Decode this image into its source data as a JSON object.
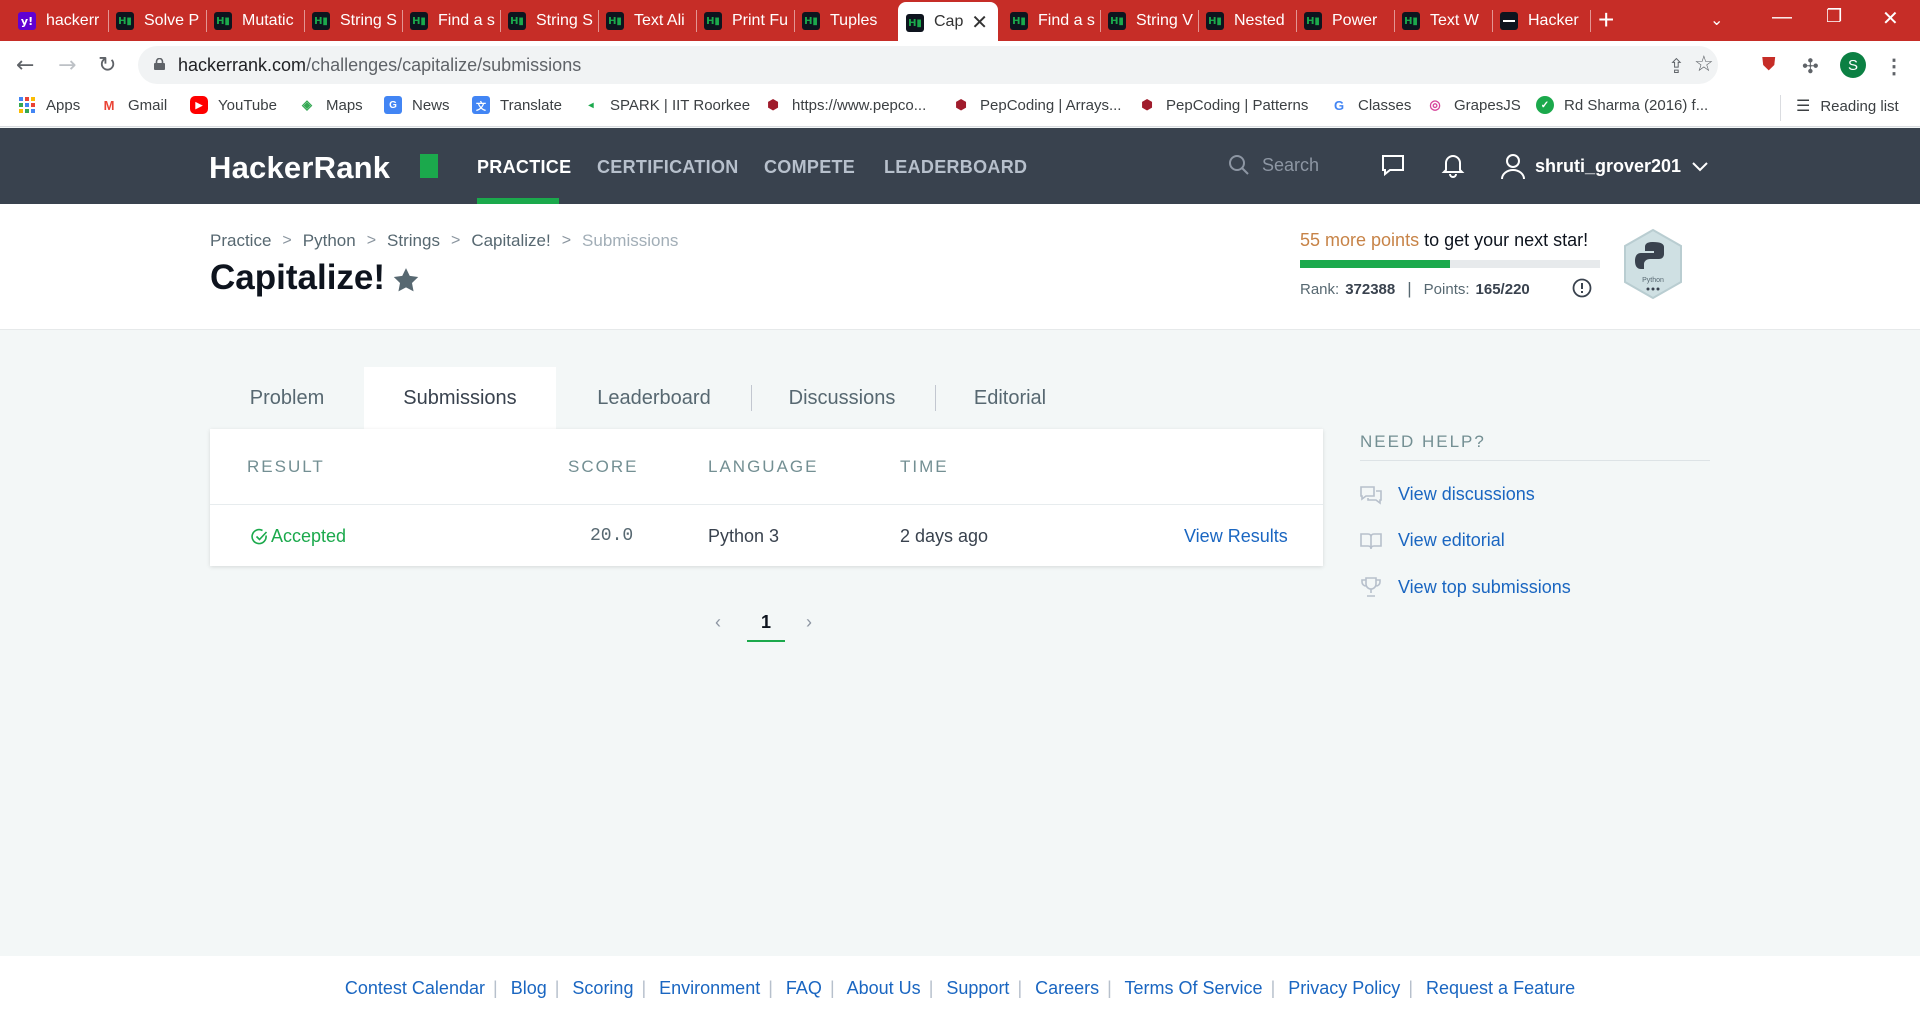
{
  "browser": {
    "tabs": [
      {
        "title": "hackerr",
        "favicon": "yahoo-icon"
      },
      {
        "title": "Solve P",
        "favicon": "hackerrank-icon"
      },
      {
        "title": "Mutatic",
        "favicon": "hackerrank-icon"
      },
      {
        "title": "String S",
        "favicon": "hackerrank-icon"
      },
      {
        "title": "Find a s",
        "favicon": "hackerrank-icon"
      },
      {
        "title": "String S",
        "favicon": "hackerrank-icon"
      },
      {
        "title": "Text Ali",
        "favicon": "hackerrank-icon"
      },
      {
        "title": "Print Fu",
        "favicon": "hackerrank-icon"
      },
      {
        "title": "Tuples",
        "favicon": "hackerrank-icon"
      },
      {
        "title": "Cap",
        "favicon": "hackerrank-icon",
        "active": true
      },
      {
        "title": "Find a s",
        "favicon": "hackerrank-icon"
      },
      {
        "title": "String V",
        "favicon": "hackerrank-icon"
      },
      {
        "title": "Nested",
        "favicon": "hackerrank-icon"
      },
      {
        "title": "Power",
        "favicon": "hackerrank-icon"
      },
      {
        "title": "Text W",
        "favicon": "hackerrank-icon"
      },
      {
        "title": "Hacker",
        "favicon": "hackerrank-dark-icon"
      }
    ],
    "url_host": "hackerrank.com",
    "url_path": "/challenges/capitalize/submissions",
    "profile_initial": "S",
    "bookmarks": [
      {
        "label": "Apps",
        "icon": "apps-grid-icon"
      },
      {
        "label": "Gmail",
        "icon": "gmail-icon"
      },
      {
        "label": "YouTube",
        "icon": "youtube-icon"
      },
      {
        "label": "Maps",
        "icon": "maps-icon"
      },
      {
        "label": "News",
        "icon": "news-icon"
      },
      {
        "label": "Translate",
        "icon": "translate-icon"
      },
      {
        "label": "SPARK | IIT Roorkee",
        "icon": "spark-icon"
      },
      {
        "label": "https://www.pepco...",
        "icon": "pepcoding-icon"
      },
      {
        "label": "PepCoding | Arrays...",
        "icon": "pepcoding-icon"
      },
      {
        "label": "PepCoding | Patterns",
        "icon": "pepcoding-icon"
      },
      {
        "label": "Classes",
        "icon": "google-icon"
      },
      {
        "label": "GrapesJS",
        "icon": "grapesjs-icon"
      },
      {
        "label": "Rd Sharma (2016) f...",
        "icon": "rd-sharma-icon"
      }
    ],
    "reading_list": "Reading list"
  },
  "hr_nav": {
    "logo": "HackerRank",
    "links": [
      "PRACTICE",
      "CERTIFICATION",
      "COMPETE",
      "LEADERBOARD"
    ],
    "search_placeholder": "Search",
    "username": "shruti_grover201"
  },
  "header": {
    "breadcrumbs": [
      "Practice",
      "Python",
      "Strings",
      "Capitalize!",
      "Submissions"
    ],
    "title": "Capitalize!",
    "points_needed": "55 more points",
    "points_suffix": " to get your next star!",
    "progress_fraction": 0.5,
    "rank_label": "Rank:",
    "rank_value": "372388",
    "points_label": "Points:",
    "points_value": "165/220",
    "badge_label": "Python"
  },
  "tabs": [
    "Problem",
    "Submissions",
    "Leaderboard",
    "Discussions",
    "Editorial"
  ],
  "submissions": {
    "columns": [
      "RESULT",
      "SCORE",
      "LANGUAGE",
      "TIME"
    ],
    "rows": [
      {
        "result": "Accepted",
        "score": "20.0",
        "language": "Python 3",
        "time": "2 days ago",
        "action": "View Results"
      }
    ]
  },
  "pagination": {
    "current": "1"
  },
  "help": {
    "title": "NEED HELP?",
    "items": [
      "View discussions",
      "View editorial",
      "View top submissions"
    ]
  },
  "footer": {
    "links": [
      "Contest Calendar",
      "Blog",
      "Scoring",
      "Environment",
      "FAQ",
      "About Us",
      "Support",
      "Careers",
      "Terms Of Service",
      "Privacy Policy",
      "Request a Feature"
    ]
  },
  "colors": {
    "accent": "#1ba94c",
    "nav_bg": "#39424e",
    "link": "#1a66c1",
    "tabbar": "#c62d27"
  }
}
